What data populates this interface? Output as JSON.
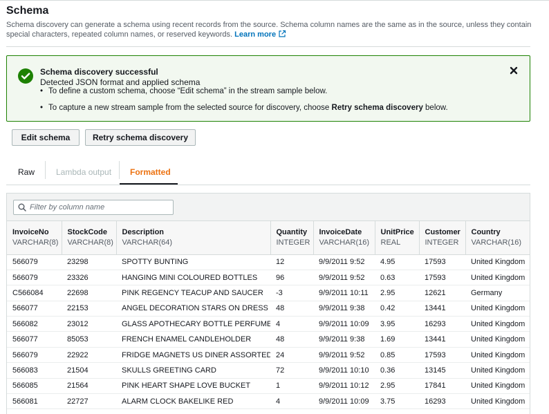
{
  "header": {
    "title": "Schema",
    "description": "Schema discovery can generate a schema using recent records from the source. Schema column names are the same as in the source, unless they contain special characters, repeated column names, or reserved keywords.",
    "learn_more": "Learn more"
  },
  "alert": {
    "title": "Schema discovery successful",
    "subtitle": "Detected JSON format and applied schema",
    "bullet1": "To define a custom schema, choose “Edit schema” in the stream sample below.",
    "bullet2_pre": "To capture a new stream sample from the selected source for discovery, choose ",
    "bullet2_bold": "Retry schema discovery",
    "bullet2_post": " below.",
    "color": "#1d8102"
  },
  "buttons": {
    "edit": "Edit schema",
    "retry": "Retry schema discovery"
  },
  "tabs": {
    "raw": "Raw",
    "lambda": "Lambda output",
    "formatted": "Formatted",
    "active_color": "#ec7211"
  },
  "filter": {
    "placeholder": "Filter by column name"
  },
  "columns": [
    {
      "name": "InvoiceNo",
      "type": "VARCHAR(8)"
    },
    {
      "name": "StockCode",
      "type": "VARCHAR(8)"
    },
    {
      "name": "Description",
      "type": "VARCHAR(64)"
    },
    {
      "name": "Quantity",
      "type": "INTEGER"
    },
    {
      "name": "InvoiceDate",
      "type": "VARCHAR(16)"
    },
    {
      "name": "UnitPrice",
      "type": "REAL"
    },
    {
      "name": "Customer",
      "type": "INTEGER"
    },
    {
      "name": "Country",
      "type": "VARCHAR(16)"
    }
  ],
  "rows": [
    [
      "566079",
      "23298",
      "SPOTTY BUNTING",
      "12",
      "9/9/2011 9:52",
      "4.95",
      "17593",
      "United Kingdom"
    ],
    [
      "566079",
      "23326",
      "HANGING MINI COLOURED BOTTLES",
      "96",
      "9/9/2011 9:52",
      "0.63",
      "17593",
      "United Kingdom"
    ],
    [
      "C566084",
      "22698",
      "PINK REGENCY TEACUP AND SAUCER",
      "-3",
      "9/9/2011 10:11",
      "2.95",
      "12621",
      "Germany"
    ],
    [
      "566077",
      "22153",
      "ANGEL DECORATION STARS ON DRESS",
      "48",
      "9/9/2011 9:38",
      "0.42",
      "13441",
      "United Kingdom"
    ],
    [
      "566082",
      "23012",
      "GLASS APOTHECARY BOTTLE PERFUME",
      "4",
      "9/9/2011 10:09",
      "3.95",
      "16293",
      "United Kingdom"
    ],
    [
      "566077",
      "85053",
      "FRENCH ENAMEL CANDLEHOLDER",
      "48",
      "9/9/2011 9:38",
      "1.69",
      "13441",
      "United Kingdom"
    ],
    [
      "566079",
      "22922",
      "FRIDGE MAGNETS US DINER ASSORTED",
      "24",
      "9/9/2011 9:52",
      "0.85",
      "17593",
      "United Kingdom"
    ],
    [
      "566083",
      "21504",
      "SKULLS GREETING CARD",
      "72",
      "9/9/2011 10:10",
      "0.36",
      "13145",
      "United Kingdom"
    ],
    [
      "566085",
      "21564",
      "PINK HEART SHAPE LOVE BUCKET",
      "1",
      "9/9/2011 10:12",
      "2.95",
      "17841",
      "United Kingdom"
    ],
    [
      "566081",
      "22727",
      "ALARM CLOCK BAKELIKE RED",
      "4",
      "9/9/2011 10:09",
      "3.75",
      "16293",
      "United Kingdom"
    ]
  ]
}
